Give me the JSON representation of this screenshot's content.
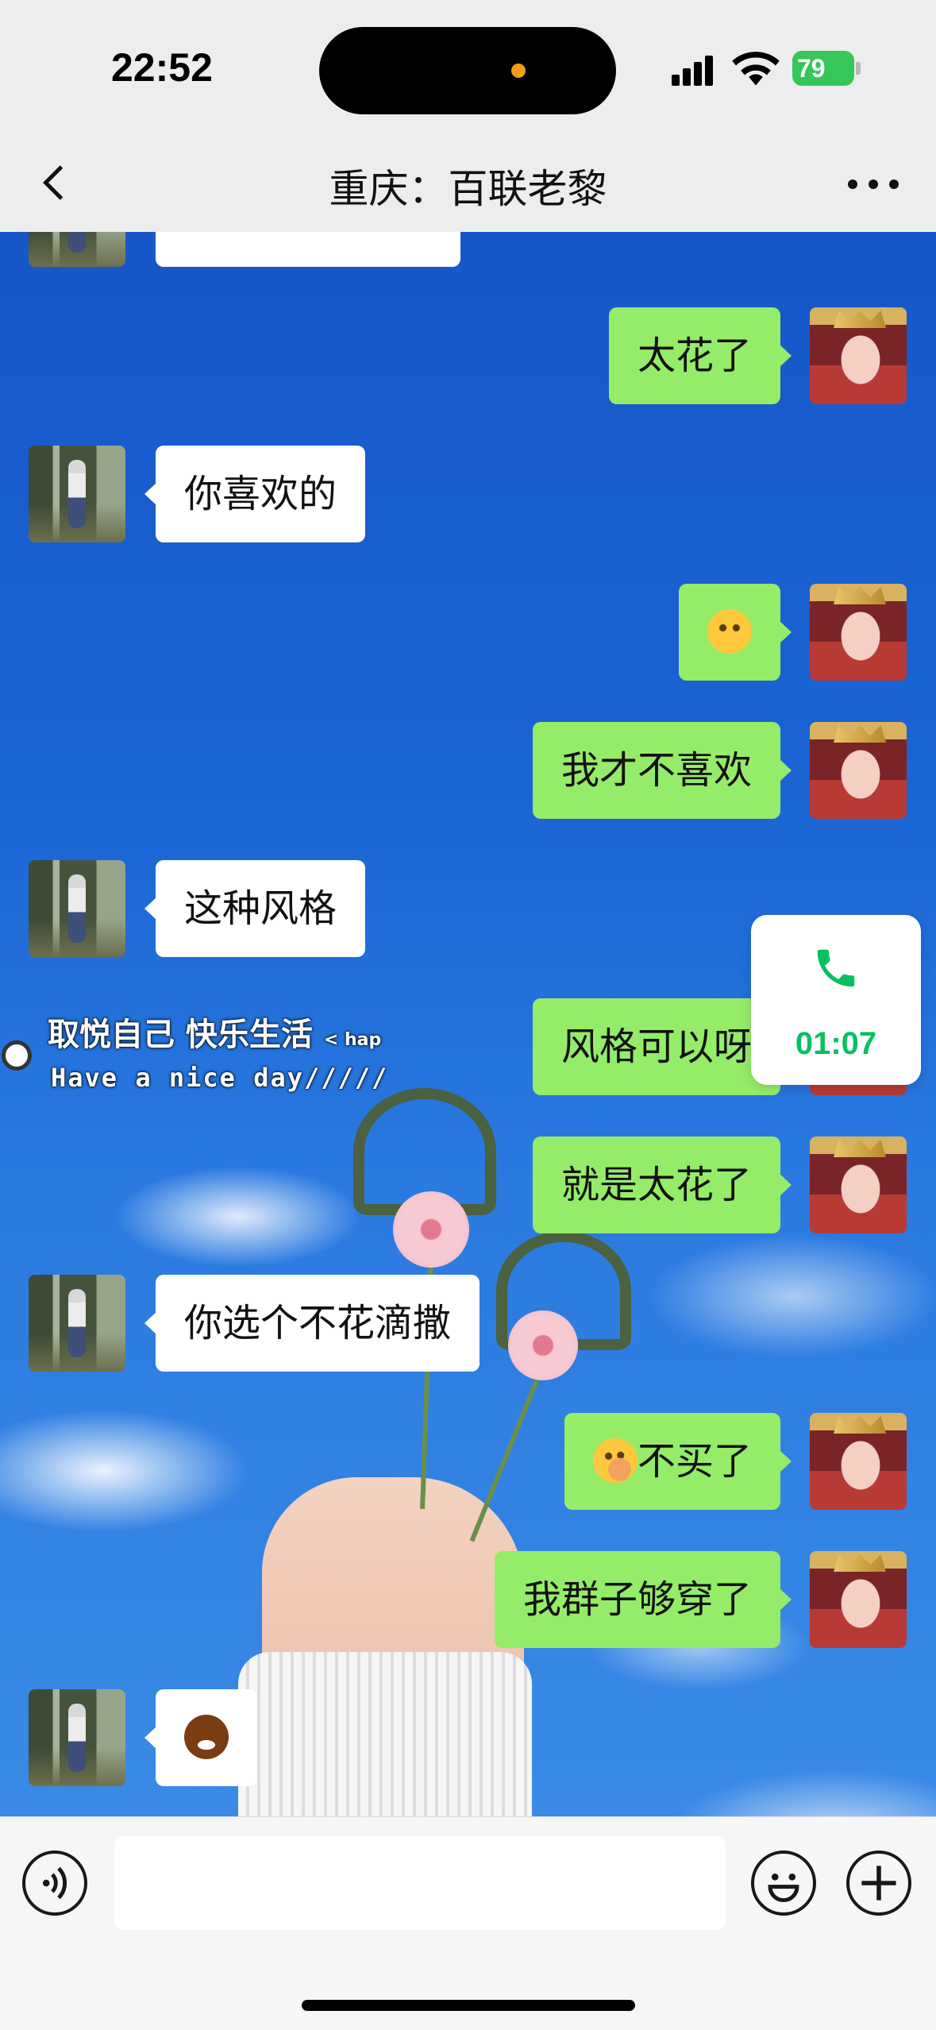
{
  "status_bar": {
    "time": "22:52",
    "battery": "79",
    "battery_color": "#35c759",
    "icons": [
      "signal-icon",
      "wifi-icon",
      "battery-icon"
    ]
  },
  "header": {
    "title": "重庆：百联老黎",
    "back_icon": "chevron-left-icon",
    "more_icon": "more-dots-icon"
  },
  "messages": [
    {
      "side": "peer",
      "text": "你喜欢的"
    },
    {
      "side": "self",
      "text": "太花了"
    },
    {
      "side": "self",
      "emoji": "unamused-face"
    },
    {
      "side": "self",
      "text": "我才不喜欢"
    },
    {
      "side": "peer",
      "text": "这种风格"
    },
    {
      "side": "self",
      "text": "风格可以呀"
    },
    {
      "side": "self",
      "text": "就是太花了"
    },
    {
      "side": "peer",
      "text": "你选个不花滴撒"
    },
    {
      "side": "self",
      "text": "不买了",
      "emoji": "face-with-hand-over-mouth"
    },
    {
      "side": "self",
      "text": "我群子够穿了"
    },
    {
      "side": "peer",
      "emoji": "grinning-face"
    }
  ],
  "background_overlay": {
    "line1": "取悦自己 快乐生活",
    "line1_small": "< hap",
    "line2": "Have a nice day/////"
  },
  "call_float": {
    "duration": "01:07",
    "icon": "phone-icon",
    "color": "#07c160"
  },
  "input_bar": {
    "placeholder": "",
    "voice_icon": "voice-icon",
    "emoji_icon": "emoji-icon",
    "plus_icon": "plus-icon"
  },
  "colors": {
    "self_bubble": "#95ec69",
    "peer_bubble": "#ffffff",
    "header_bg": "#ededed"
  }
}
